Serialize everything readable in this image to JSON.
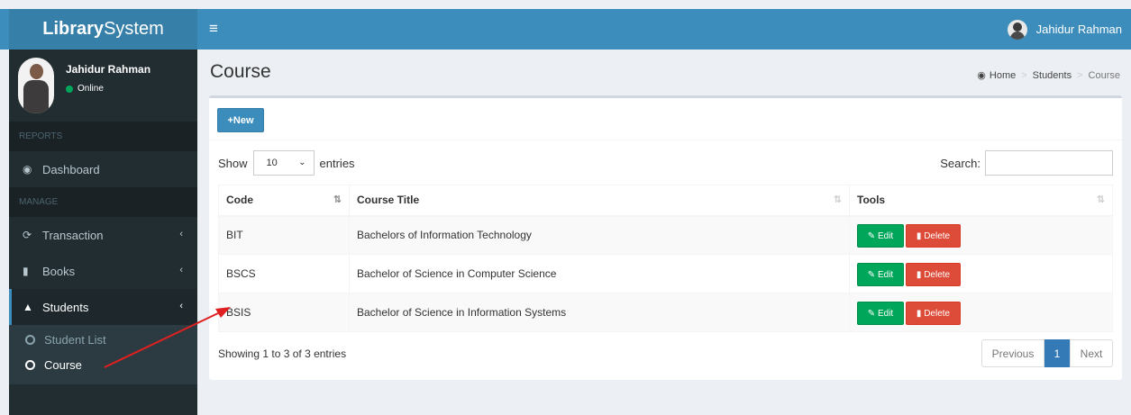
{
  "app": {
    "logo_bold": "Library",
    "logo_rest": "System",
    "menu_icon": "bars-icon",
    "user_name": "Jahidur Rahman"
  },
  "sidebar": {
    "user_name": "Jahidur Rahman",
    "status": "Online",
    "status_color": "#00a65a",
    "header_reports": "REPORTS",
    "header_manage": "MANAGE",
    "items": [
      {
        "label": "Dashboard",
        "icon": "dashboard-icon"
      },
      {
        "label": "Transaction",
        "icon": "refresh-icon"
      },
      {
        "label": "Books",
        "icon": "book-icon"
      },
      {
        "label": "Students",
        "icon": "graduation-cap-icon"
      }
    ],
    "subitems": [
      {
        "label": "Student List"
      },
      {
        "label": "Course"
      }
    ]
  },
  "page": {
    "title": "Course",
    "breadcrumb": [
      "Home",
      "Students",
      "Course"
    ]
  },
  "box": {
    "new_label": "New",
    "show_label": "Show",
    "entries_label": "entries",
    "page_size": "10",
    "search_label": "Search:",
    "columns": [
      "Code",
      "Course Title",
      "Tools"
    ],
    "rows": [
      {
        "code": "BIT",
        "title": "Bachelors of Information Technology"
      },
      {
        "code": "BSCS",
        "title": "Bachelor of Science in Computer Science"
      },
      {
        "code": "BSIS",
        "title": "Bachelor of Science in Information Systems"
      }
    ],
    "edit_label": "Edit",
    "delete_label": "Delete",
    "showing_text": "Showing 1 to 3 of 3 entries",
    "pagination": {
      "previous": "Previous",
      "current": "1",
      "next": "Next"
    }
  },
  "colors": {
    "brand": "#3c8dbc",
    "sidebar": "#222d32",
    "edit": "#00a65a",
    "delete": "#dd4b39",
    "annotation_arrow": "#e02020"
  }
}
